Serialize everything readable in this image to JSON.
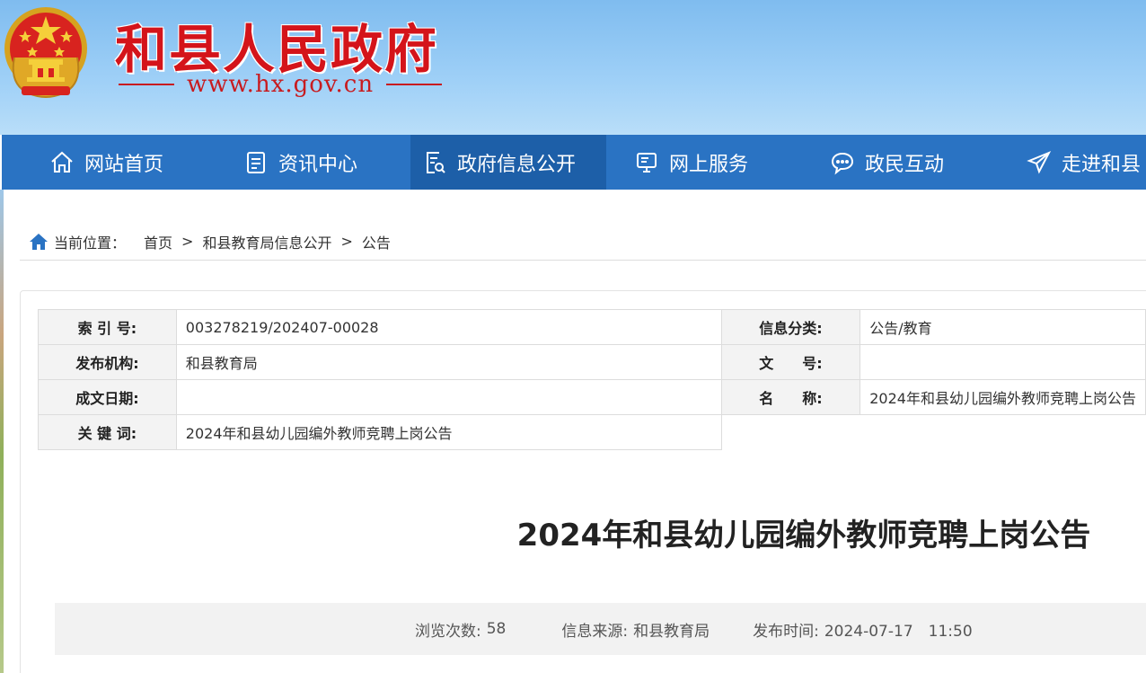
{
  "header": {
    "site_title": "和县人民政府",
    "site_url": "www.hx.gov.cn"
  },
  "nav": {
    "items": [
      {
        "label": "网站首页",
        "icon": "home-icon"
      },
      {
        "label": "资讯中心",
        "icon": "document-icon"
      },
      {
        "label": "政府信息公开",
        "icon": "file-search-icon"
      },
      {
        "label": "网上服务",
        "icon": "monitor-icon"
      },
      {
        "label": "政民互动",
        "icon": "chat-icon"
      },
      {
        "label": "走进和县",
        "icon": "paper-plane-icon"
      }
    ],
    "active_index": 2
  },
  "breadcrumb": {
    "prefix": "当前位置：",
    "items": [
      "首页",
      "和县教育局信息公开",
      "公告"
    ],
    "separator": ">"
  },
  "meta": {
    "index_no_label": "索 引 号:",
    "index_no": "003278219/202407-00028",
    "category_label": "信息分类:",
    "category": "公告/教育",
    "publisher_label": "发布机构:",
    "publisher": "和县教育局",
    "doc_no_label": "文　　号:",
    "doc_no": "",
    "date_label": "成文日期:",
    "date": "",
    "name_label": "名　　称:",
    "name": "2024年和县幼儿园编外教师竞聘上岗公告",
    "keywords_label": "关 键 词:",
    "keywords": "2024年和县幼儿园编外教师竞聘上岗公告"
  },
  "article": {
    "title": "2024年和县幼儿园编外教师竞聘上岗公告"
  },
  "info_bar": {
    "views_label": "浏览次数:",
    "views": "58",
    "source_label": "信息来源:",
    "source": "和县教育局",
    "time_label": "发布时间:",
    "time": "2024-07-17　11:50"
  },
  "colors": {
    "nav_bg": "#2a73c3",
    "nav_active": "#1d5fa8",
    "title_red": "#d4141a"
  }
}
